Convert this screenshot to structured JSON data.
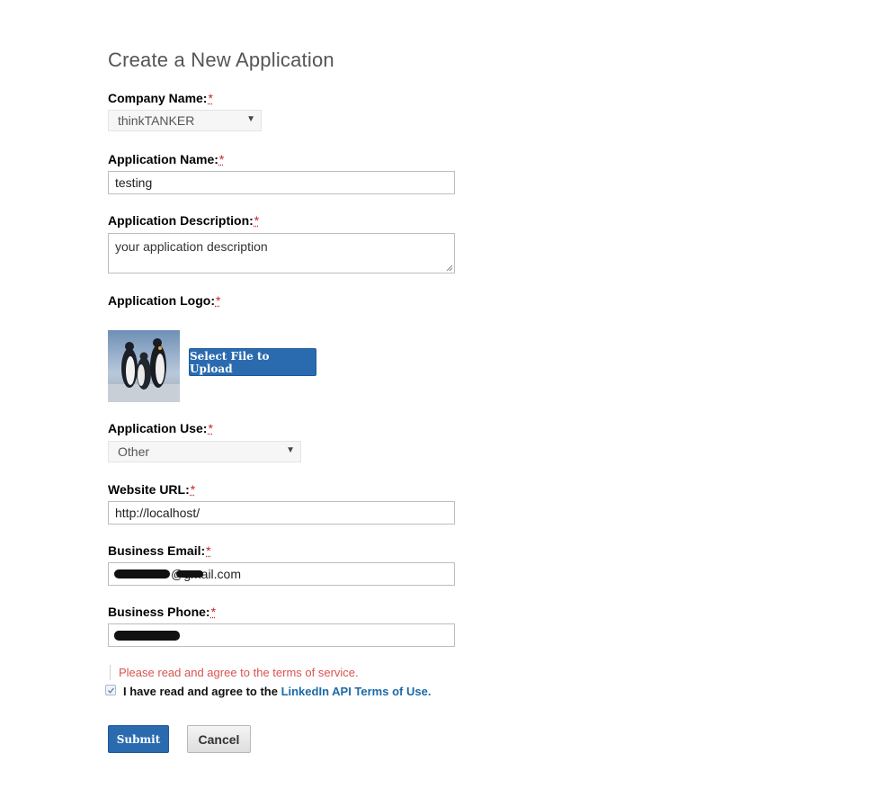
{
  "page": {
    "title": "Create a New Application"
  },
  "form": {
    "required_marker": "*",
    "company_name": {
      "label": "Company Name:",
      "value": "thinkTANKER",
      "icon": "chevron-down-icon"
    },
    "application_name": {
      "label": "Application Name:",
      "value": "testing"
    },
    "application_description": {
      "label": "Application Description:",
      "placeholder": "your application description"
    },
    "application_logo": {
      "label": "Application Logo:",
      "upload_label": "Select File to Upload",
      "image": "penguins-logo"
    },
    "application_use": {
      "label": "Application Use:",
      "value": "Other",
      "icon": "chevron-down-icon"
    },
    "website_url": {
      "label": "Website URL:",
      "value": "http://localhost/"
    },
    "business_email": {
      "label": "Business Email:",
      "visible_value": "@gmail.com"
    },
    "business_phone": {
      "label": "Business Phone:"
    },
    "terms": {
      "error": "Please read and agree to the terms of service.",
      "checked": true,
      "text": "I have read and agree to the ",
      "link_text": "LinkedIn API Terms of Use."
    },
    "actions": {
      "submit_label": "Submit",
      "cancel_label": "Cancel"
    }
  },
  "colors": {
    "primary": "#2a6bb0",
    "error": "#d9534f",
    "link": "#1a6aa8"
  }
}
